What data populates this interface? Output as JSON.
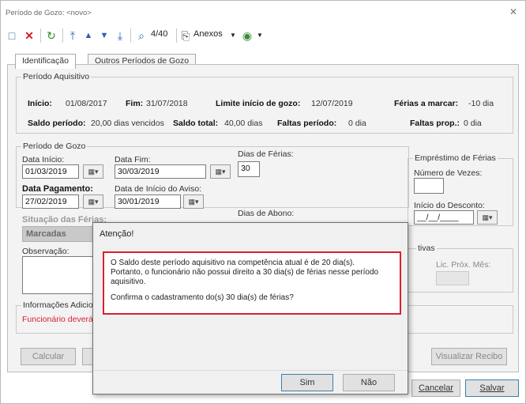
{
  "window": {
    "title": "Período de Gozo: <novo>"
  },
  "toolbar": {
    "record_counter": "4/40",
    "anexos_label": "Anexos"
  },
  "tabs": [
    {
      "label": "Identificação",
      "active": true
    },
    {
      "label": "Outros Períodos de Gozo",
      "active": false
    }
  ],
  "periodo_aquisitivo": {
    "title": "Período Aquisitivo",
    "inicio_label": "Início:",
    "inicio_value": "01/08/2017",
    "fim_label": "Fim:",
    "fim_value": "31/07/2018",
    "limite_label": "Limite início de gozo:",
    "limite_value": "12/07/2019",
    "ferias_marcar_label": "Férias a marcar:",
    "ferias_marcar_value": "-10 dia",
    "saldo_periodo_label": "Saldo período:",
    "saldo_periodo_value": "20,00 dias vencidos",
    "saldo_total_label": "Saldo total:",
    "saldo_total_value": "40,00 dias",
    "faltas_periodo_label": "Faltas período:",
    "faltas_periodo_value": "0 dia",
    "faltas_prop_label": "Faltas prop.:",
    "faltas_prop_value": "0 dia"
  },
  "periodo_gozo": {
    "title": "Período de Gozo",
    "data_inicio_label": "Data Início:",
    "data_inicio_value": "01/03/2019",
    "data_fim_label": "Data Fim:",
    "data_fim_value": "30/03/2019",
    "dias_ferias_label": "Dias de Férias:",
    "dias_ferias_value": "30",
    "data_pagamento_label": "Data Pagamento:",
    "data_pagamento_value": "27/02/2019",
    "data_aviso_label": "Data de Início do Aviso:",
    "data_aviso_value": "30/01/2019",
    "dias_abono_label": "Dias de Abono:",
    "situacao_label": "Situação das Férias:",
    "situacao_value": "Marcadas"
  },
  "emprestimo": {
    "title": "Empréstimo de Férias",
    "numero_vezes_label": "Número de Vezes:",
    "inicio_desconto_label": "Início do Desconto:",
    "inicio_desconto_placeholder": "__/__/____"
  },
  "observacao_label": "Observação:",
  "licencas": {
    "title": "tivas",
    "lic_prox_mes_label": "Lic. Próx. Mês:"
  },
  "informacoes": {
    "title": "Informações Adicio",
    "warning_text": "Funcionário deverá"
  },
  "buttons": {
    "calcular": "Calcular",
    "visualizar_recibo": "Visualizar Recibo",
    "cancelar": "Cancelar",
    "salvar": "Salvar"
  },
  "dialog": {
    "title": "Atenção!",
    "line1": "O Saldo deste período aquisitivo na competência atual é de 20 dia(s).",
    "line2": "Portanto, o funcionário não possui direito a 30 dia(s) de férias nesse período",
    "line3": "aquisitivo.",
    "line4": "Confirma o cadastramento do(s) 30 dia(s) de férias?",
    "yes": "Sim",
    "no": "Não"
  },
  "colors": {
    "warning_red": "#d9202f",
    "dialog_border_red": "#d9202f"
  }
}
